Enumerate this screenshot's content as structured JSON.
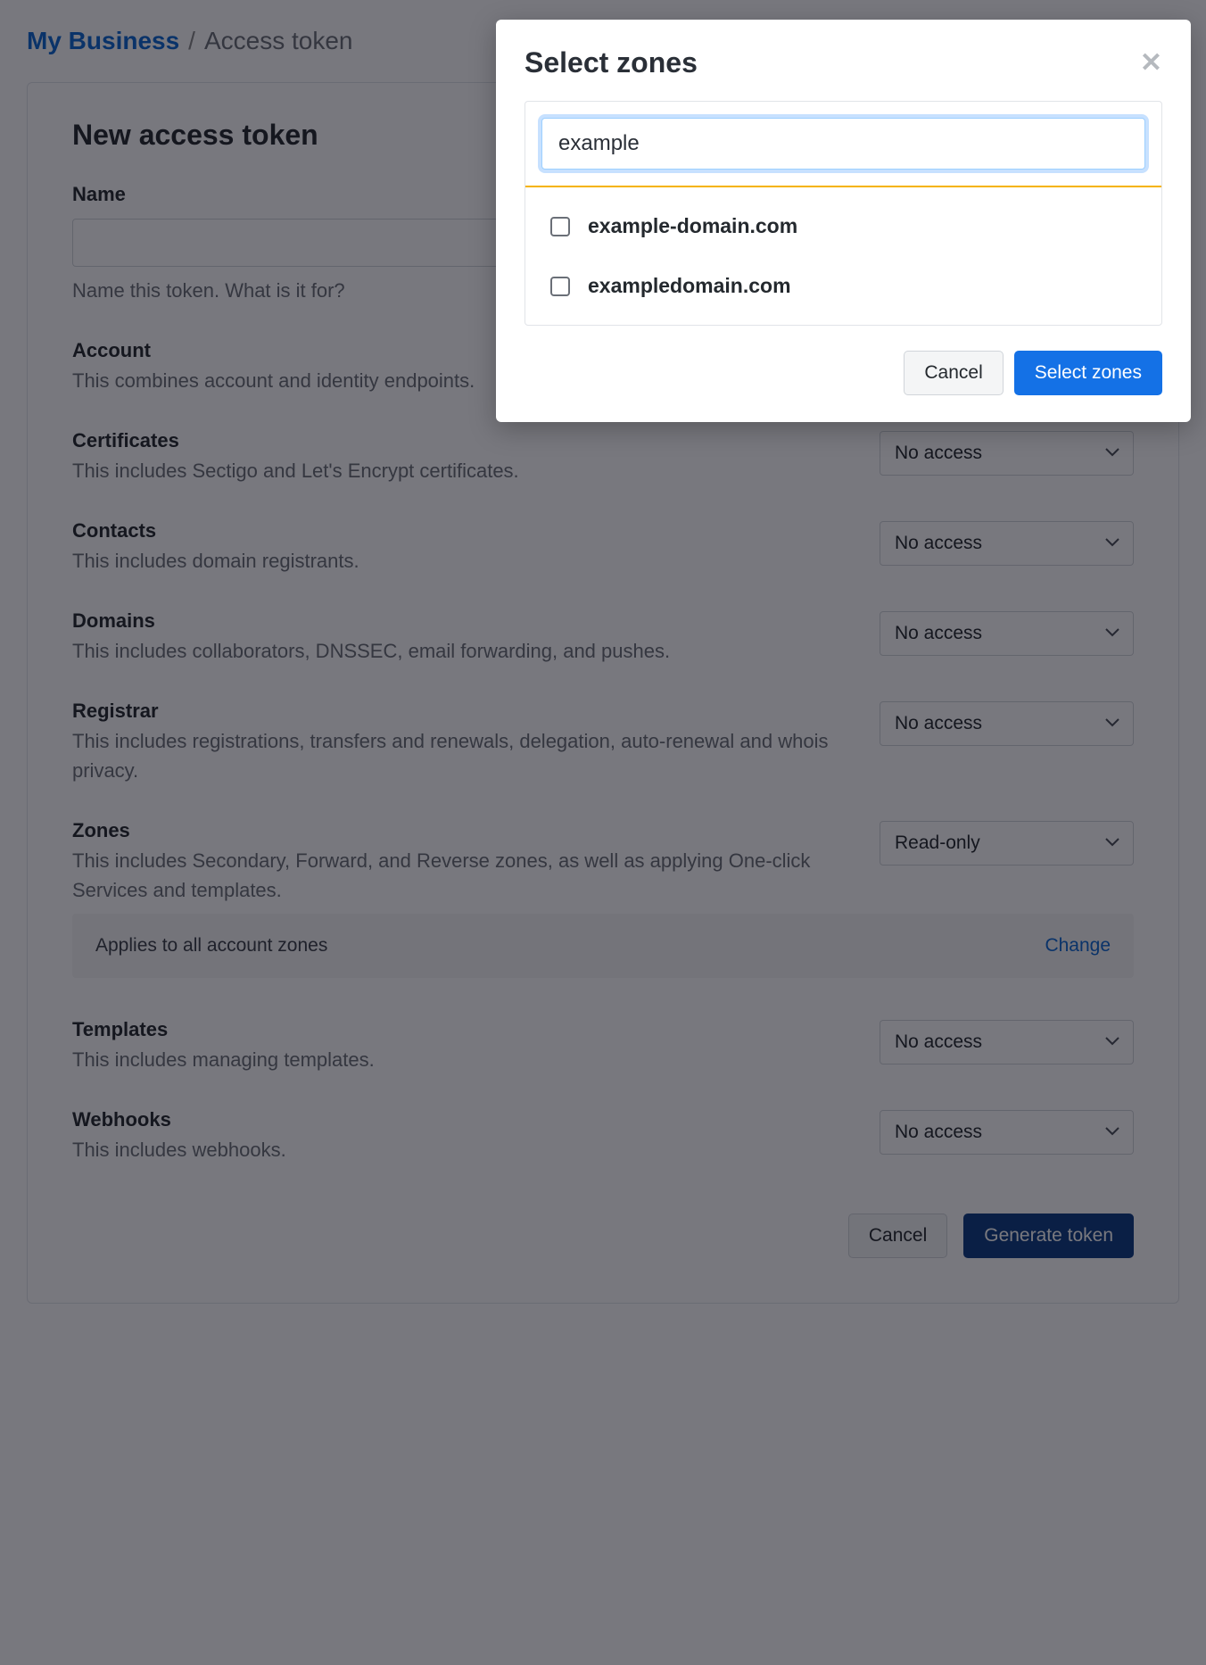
{
  "breadcrumb": {
    "link_text": "My Business",
    "separator": "/",
    "current": "Access token"
  },
  "panel": {
    "title": "New access token",
    "name": {
      "label": "Name",
      "value": "",
      "help": "Name this token. What is it for?"
    },
    "permissions": [
      {
        "label": "Account",
        "desc": "This combines account and identity endpoints.",
        "value": ""
      },
      {
        "label": "Certificates",
        "desc": "This includes Sectigo and Let's Encrypt certificates.",
        "value": "No access"
      },
      {
        "label": "Contacts",
        "desc": "This includes domain registrants.",
        "value": "No access"
      },
      {
        "label": "Domains",
        "desc": "This includes collaborators, DNSSEC, email forwarding, and pushes.",
        "value": "No access"
      },
      {
        "label": "Registrar",
        "desc": "This includes registrations, transfers and renewals, delegation, auto-renewal and whois privacy.",
        "value": "No access"
      },
      {
        "label": "Zones",
        "desc": "This includes Secondary, Forward, and Reverse zones, as well as applying One-click Services and templates.",
        "value": "Read-only"
      },
      {
        "label": "Templates",
        "desc": "This includes managing templates.",
        "value": "No access"
      },
      {
        "label": "Webhooks",
        "desc": "This includes webhooks.",
        "value": "No access"
      }
    ],
    "applies": {
      "text": "Applies to all account zones",
      "change": "Change"
    },
    "footer": {
      "cancel": "Cancel",
      "generate": "Generate token"
    }
  },
  "modal": {
    "title": "Select zones",
    "search_value": "example",
    "zones": [
      {
        "label": "example-domain.com",
        "checked": false
      },
      {
        "label": "exampledomain.com",
        "checked": false
      }
    ],
    "footer": {
      "cancel": "Cancel",
      "select": "Select zones"
    }
  }
}
